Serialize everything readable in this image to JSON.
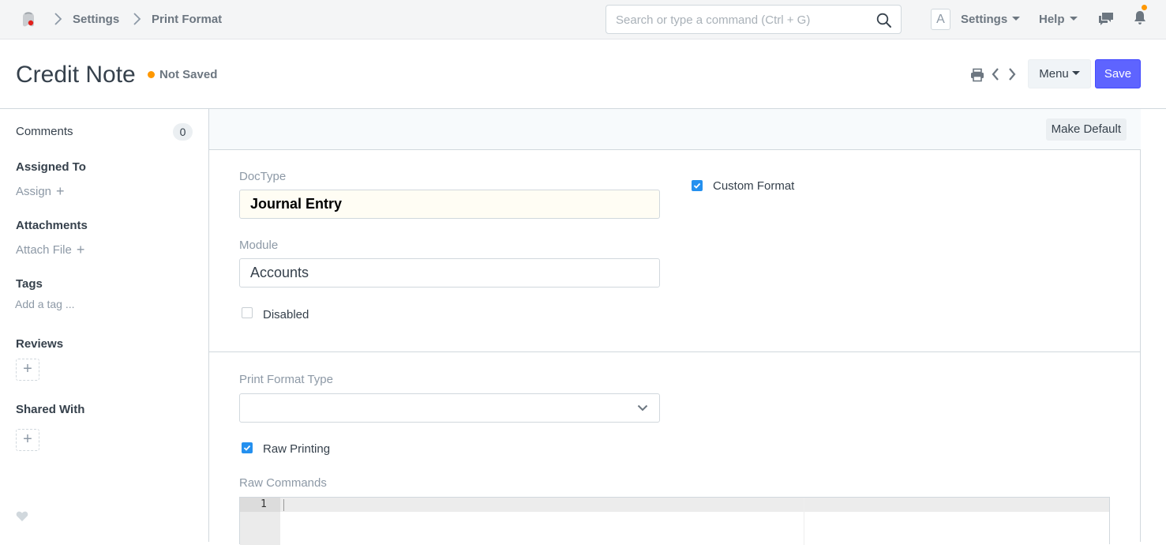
{
  "navbar": {
    "breadcrumbs": [
      "Settings",
      "Print Format"
    ],
    "search_placeholder": "Search or type a command (Ctrl + G)",
    "avatar_letter": "A",
    "settings_label": "Settings",
    "help_label": "Help"
  },
  "page": {
    "title": "Credit Note",
    "status": "Not Saved",
    "menu_label": "Menu",
    "save_label": "Save"
  },
  "sidebar": {
    "comments_label": "Comments",
    "comments_count": "0",
    "assigned_to_heading": "Assigned To",
    "assign_label": "Assign",
    "attachments_heading": "Attachments",
    "attach_label": "Attach File",
    "tags_heading": "Tags",
    "add_tag_label": "Add a tag ...",
    "reviews_heading": "Reviews",
    "shared_with_heading": "Shared With"
  },
  "form": {
    "make_default_label": "Make Default",
    "doctype_label": "DocType",
    "doctype_value": "Journal Entry",
    "module_label": "Module",
    "module_value": "Accounts",
    "disabled_label": "Disabled",
    "disabled_checked": false,
    "custom_format_label": "Custom Format",
    "custom_format_checked": true,
    "print_format_type_label": "Print Format Type",
    "print_format_type_value": "",
    "raw_printing_label": "Raw Printing",
    "raw_printing_checked": true,
    "raw_commands_label": "Raw Commands",
    "raw_commands_line_number": "1"
  },
  "colors": {
    "primary": "#5e64ff",
    "checkbox_on": "#2490ef",
    "status_dot": "#ff9800"
  }
}
